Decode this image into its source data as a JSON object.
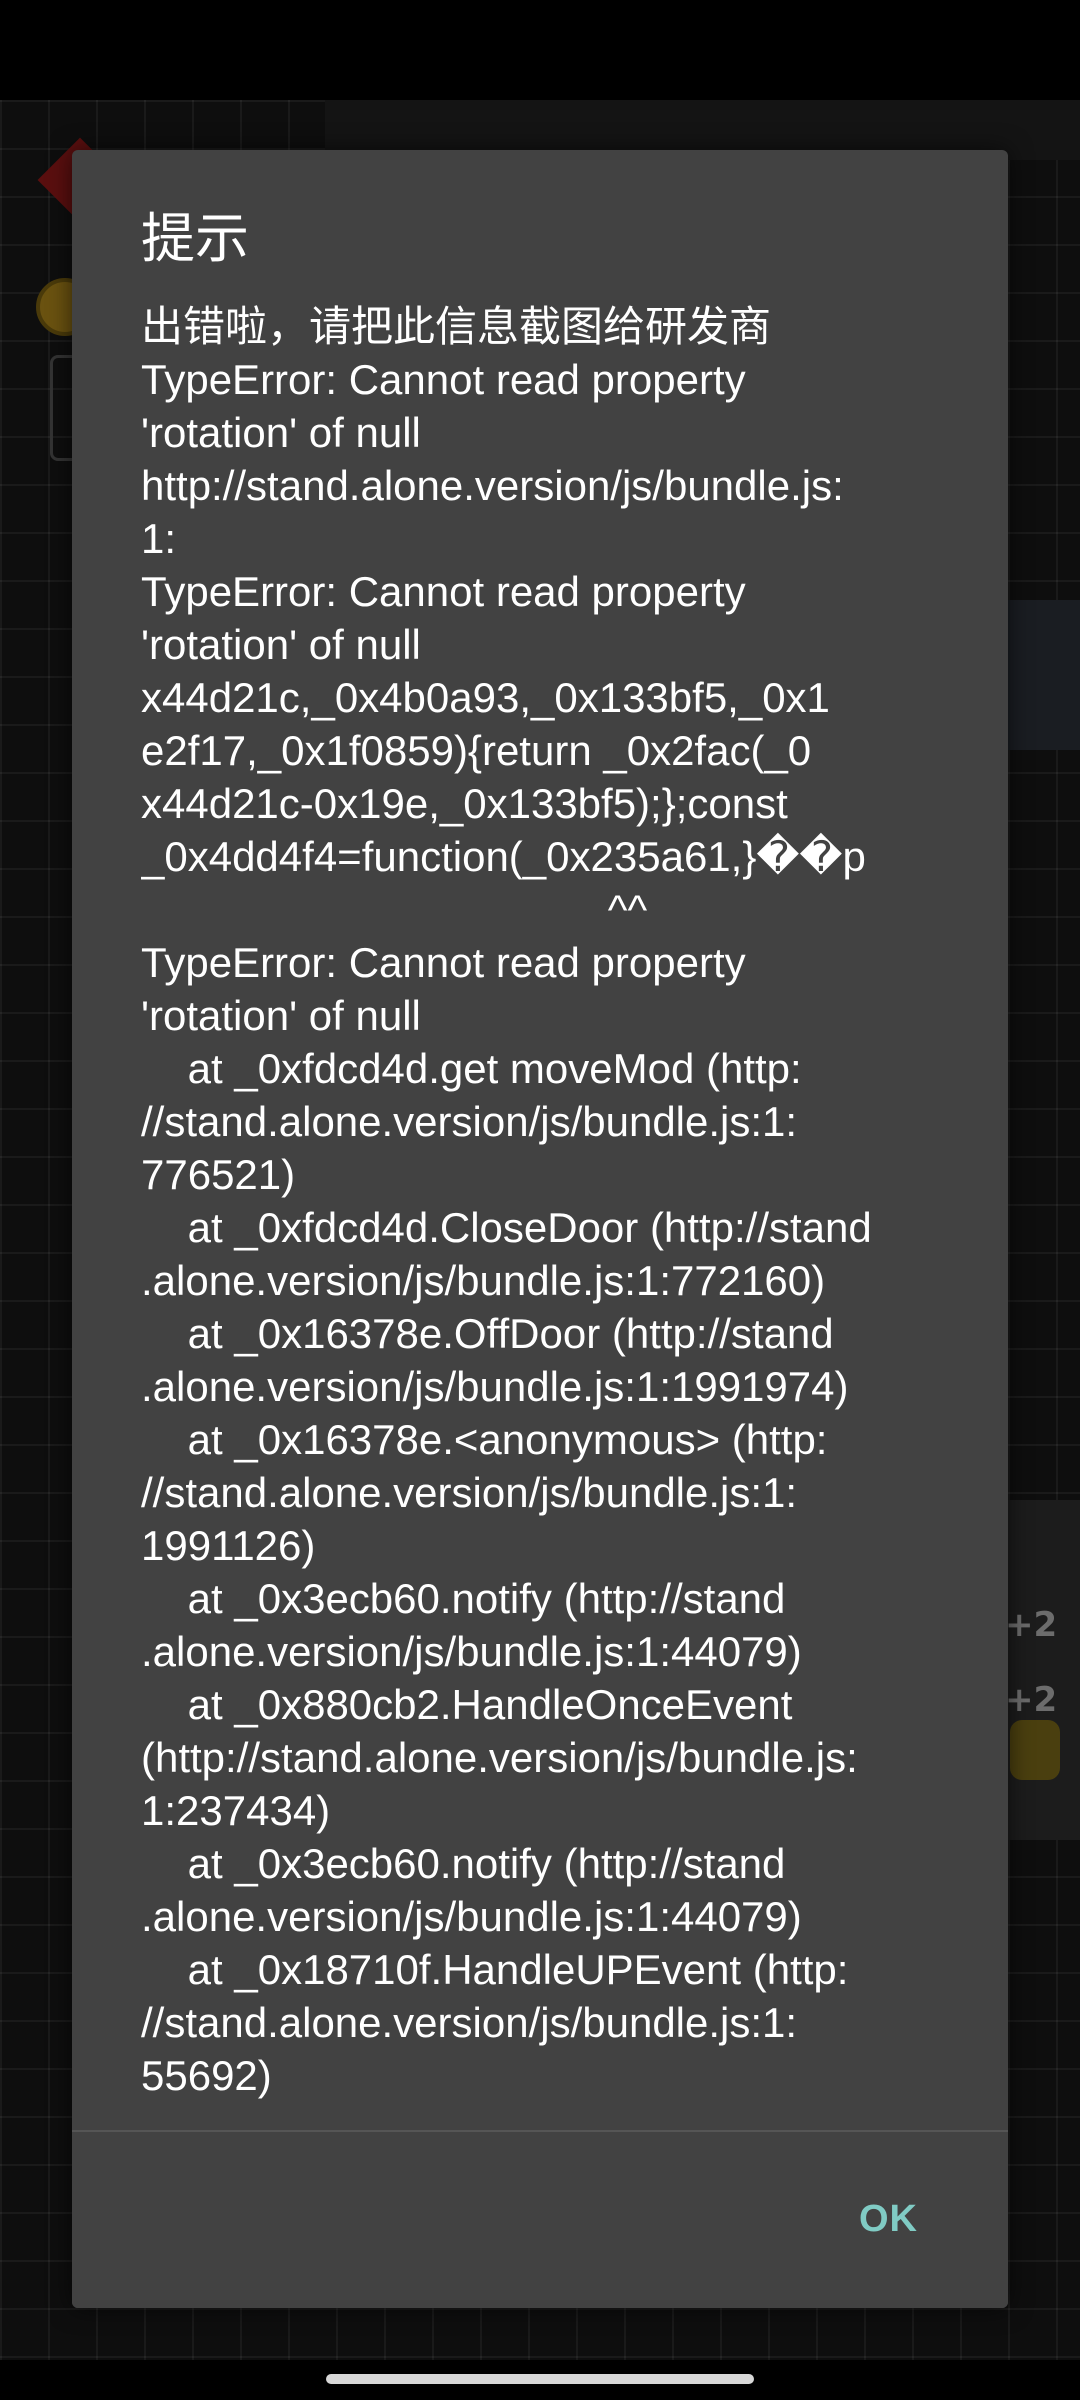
{
  "dialog": {
    "title": "提示",
    "message_lines": [
      "出错啦，请把此信息截图给研发商",
      "TypeError: Cannot read property",
      "'rotation' of null",
      "http://stand.alone.version/js/bundle.js:",
      "1:",
      "TypeError: Cannot read property",
      "'rotation' of null",
      "x44d21c,_0x4b0a93,_0x133bf5,_0x1",
      "e2f17,_0x1f0859){return _0x2fac(_0",
      "x44d21c-0x19e,_0x133bf5);};const",
      "_0x4dd4f4=function(_0x235a61,}��p",
      "                                        ^^",
      "TypeError: Cannot read property",
      "'rotation' of null",
      "    at _0xfdcd4d.get moveMod (http:",
      "//stand.alone.version/js/bundle.js:1:",
      "776521)",
      "    at _0xfdcd4d.CloseDoor (http://stand",
      ".alone.version/js/bundle.js:1:772160)",
      "    at _0x16378e.OffDoor (http://stand",
      ".alone.version/js/bundle.js:1:1991974)",
      "    at _0x16378e.<anonymous> (http:",
      "//stand.alone.version/js/bundle.js:1:",
      "1991126)",
      "    at _0x3ecb60.notify (http://stand",
      ".alone.version/js/bundle.js:1:44079)",
      "    at _0x880cb2.HandleOnceEvent",
      "(http://stand.alone.version/js/bundle.js:",
      "1:237434)",
      "    at _0x3ecb60.notify (http://stand",
      ".alone.version/js/bundle.js:1:44079)",
      "    at _0x18710f.HandleUPEvent (http:",
      "//stand.alone.version/js/bundle.js:1:",
      "55692)"
    ],
    "ok_label": "OK"
  },
  "background": {
    "plus_badges": [
      "+2",
      "+2"
    ]
  },
  "colors": {
    "dialog_bg": "#424242",
    "accent": "#80cbc4",
    "text": "#ffffff"
  }
}
